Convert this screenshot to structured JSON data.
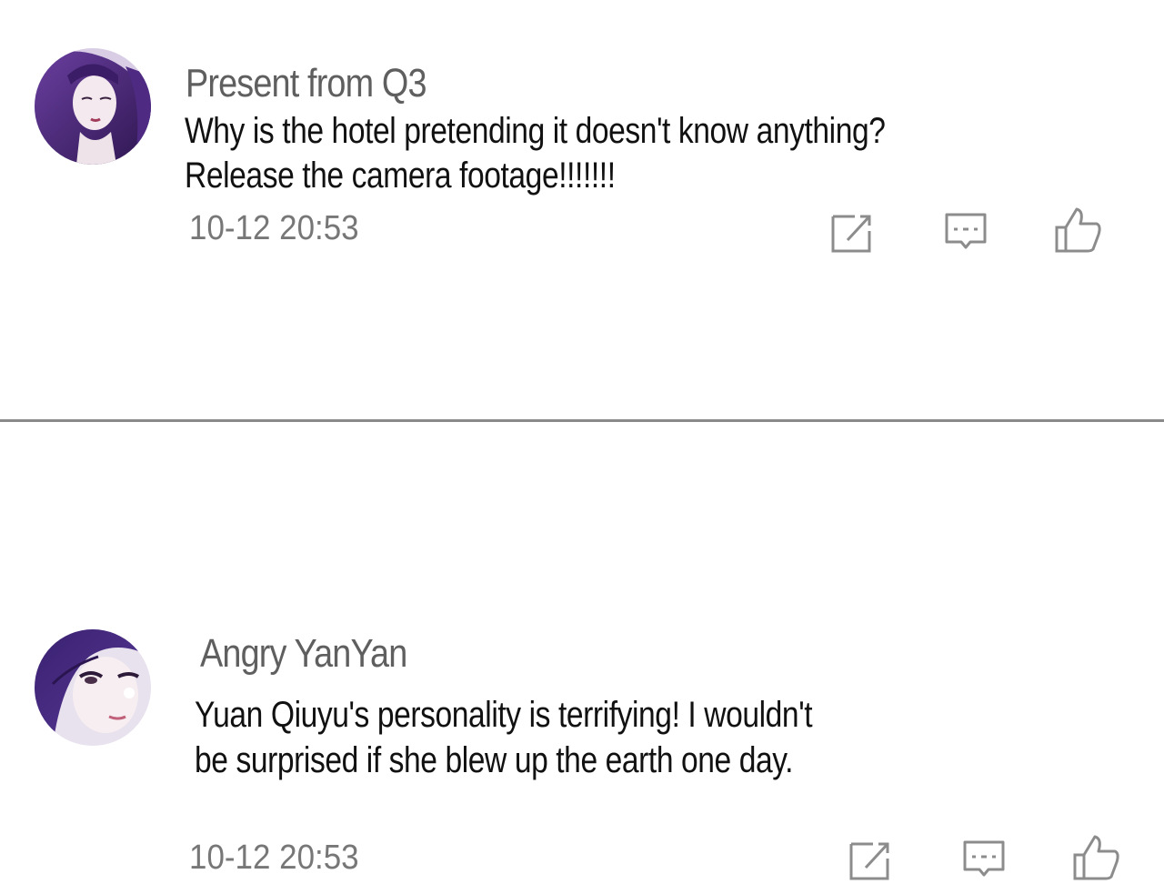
{
  "comments": [
    {
      "username": "Present from Q3",
      "lines": [
        "Why is the hotel pretending it doesn't know anything?",
        "Release the camera footage!!!!!!!"
      ],
      "timestamp": "10-12  20:53",
      "actions": [
        "share-icon",
        "reply-icon",
        "like-icon"
      ]
    },
    {
      "username": "Angry YanYan",
      "lines": [
        "Yuan Qiuyu's personality is terrifying! I wouldn't",
        "be surprised if she blew up the earth one day."
      ],
      "timestamp": "10-12  20:53",
      "actions": [
        "share-icon",
        "reply-icon",
        "like-icon"
      ]
    }
  ],
  "colors": {
    "username": "#5f5f5f",
    "text": "#111111",
    "timestamp": "#777777",
    "icon": "#8c8c8c",
    "divider": "#8a8a8a",
    "avatar_primary": "#4b2a7a"
  }
}
